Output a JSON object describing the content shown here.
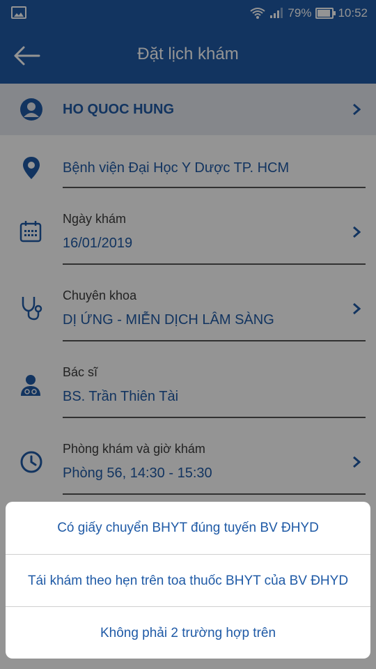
{
  "status_bar": {
    "battery_percent_text": "79%",
    "battery_level": 0.79,
    "time": "10:52",
    "icons": [
      "gallery-icon",
      "wifi-icon",
      "signal-icon",
      "battery-icon"
    ]
  },
  "app_bar": {
    "title": "Đặt lịch khám",
    "back_icon": "arrow-left-icon"
  },
  "patient": {
    "name": "HO QUOC HUNG",
    "icon": "user-circle-icon"
  },
  "form": {
    "hospital": {
      "value": "Bệnh viện Đại Học Y Dược TP. HCM",
      "icon": "map-pin-icon"
    },
    "date": {
      "label": "Ngày khám",
      "value": "16/01/2019",
      "icon": "calendar-icon"
    },
    "specialty": {
      "label": "Chuyên khoa",
      "value": "DỊ ỨNG - MIỄN DỊCH LÂM SÀNG",
      "icon": "stethoscope-icon"
    },
    "doctor": {
      "label": "Bác sĩ",
      "value": "BS. Trần Thiên Tài",
      "icon": "doctor-icon"
    },
    "room_time": {
      "label": "Phòng khám và giờ khám",
      "value": "Phòng 56, 14:30 - 15:30",
      "icon": "clock-icon"
    }
  },
  "sheet": {
    "options": [
      "Có giấy chuyển BHYT đúng tuyến BV ĐHYD",
      "Tái khám theo hẹn trên toa thuốc BHYT của BV ĐHYD",
      "Không phải 2 trường hợp trên"
    ]
  },
  "colors": {
    "primary": "#1f5aa6",
    "patient_row_bg": "#e6e9ef",
    "overlay": "rgba(0,0,0,0.42)"
  }
}
